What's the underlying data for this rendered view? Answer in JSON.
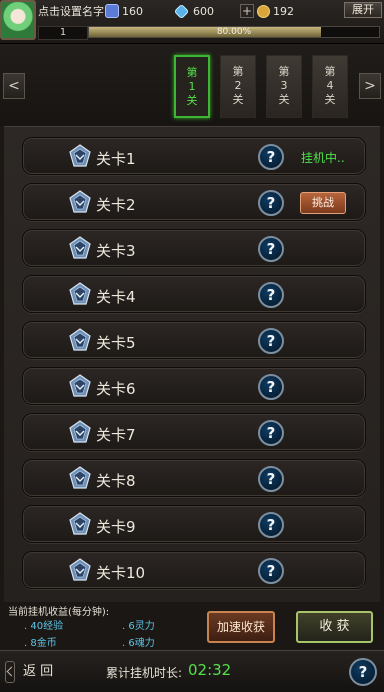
{
  "header": {
    "player_name": "点击设置名字",
    "level": "1",
    "exp_percent_text": "80.00%",
    "exp_fraction": 0.8,
    "resources": {
      "vip_value": "160",
      "diamond_value": "600",
      "gold_value": "192"
    },
    "plus_label": "+",
    "expand_label": "展开"
  },
  "chapters": {
    "tabs": [
      {
        "label": [
          "第",
          "1",
          "关"
        ],
        "active": true
      },
      {
        "label": [
          "第",
          "2",
          "关"
        ],
        "active": false
      },
      {
        "label": [
          "第",
          "3",
          "关"
        ],
        "active": false
      },
      {
        "label": [
          "第",
          "4",
          "关"
        ],
        "active": false
      }
    ],
    "prev_arrow": "<",
    "next_arrow": ">"
  },
  "stages": [
    {
      "label": "关卡1",
      "help": "?",
      "status": "挂机中.."
    },
    {
      "label": "关卡2",
      "help": "?",
      "action": "挑战"
    },
    {
      "label": "关卡3",
      "help": "?"
    },
    {
      "label": "关卡4",
      "help": "?"
    },
    {
      "label": "关卡5",
      "help": "?"
    },
    {
      "label": "关卡6",
      "help": "?"
    },
    {
      "label": "关卡7",
      "help": "?"
    },
    {
      "label": "关卡8",
      "help": "?"
    },
    {
      "label": "关卡9",
      "help": "?"
    },
    {
      "label": "关卡10",
      "help": "?"
    }
  ],
  "income": {
    "title": "当前挂机收益(每分钟):",
    "exp": ". 40经验",
    "gold": ". 8金币",
    "spirit": ". 6灵力",
    "soul": ". 6魂力"
  },
  "buttons": {
    "speed_up": "加速收获",
    "collect": "收 获"
  },
  "footer": {
    "back_label": "返 回",
    "total_time_label": "累计挂机时长:",
    "total_time_value": "02:32",
    "help": "?"
  },
  "colors": {
    "active_green": "#3db633",
    "status_green": "#4ee04a",
    "accent_blue": "#5fc5e6"
  }
}
